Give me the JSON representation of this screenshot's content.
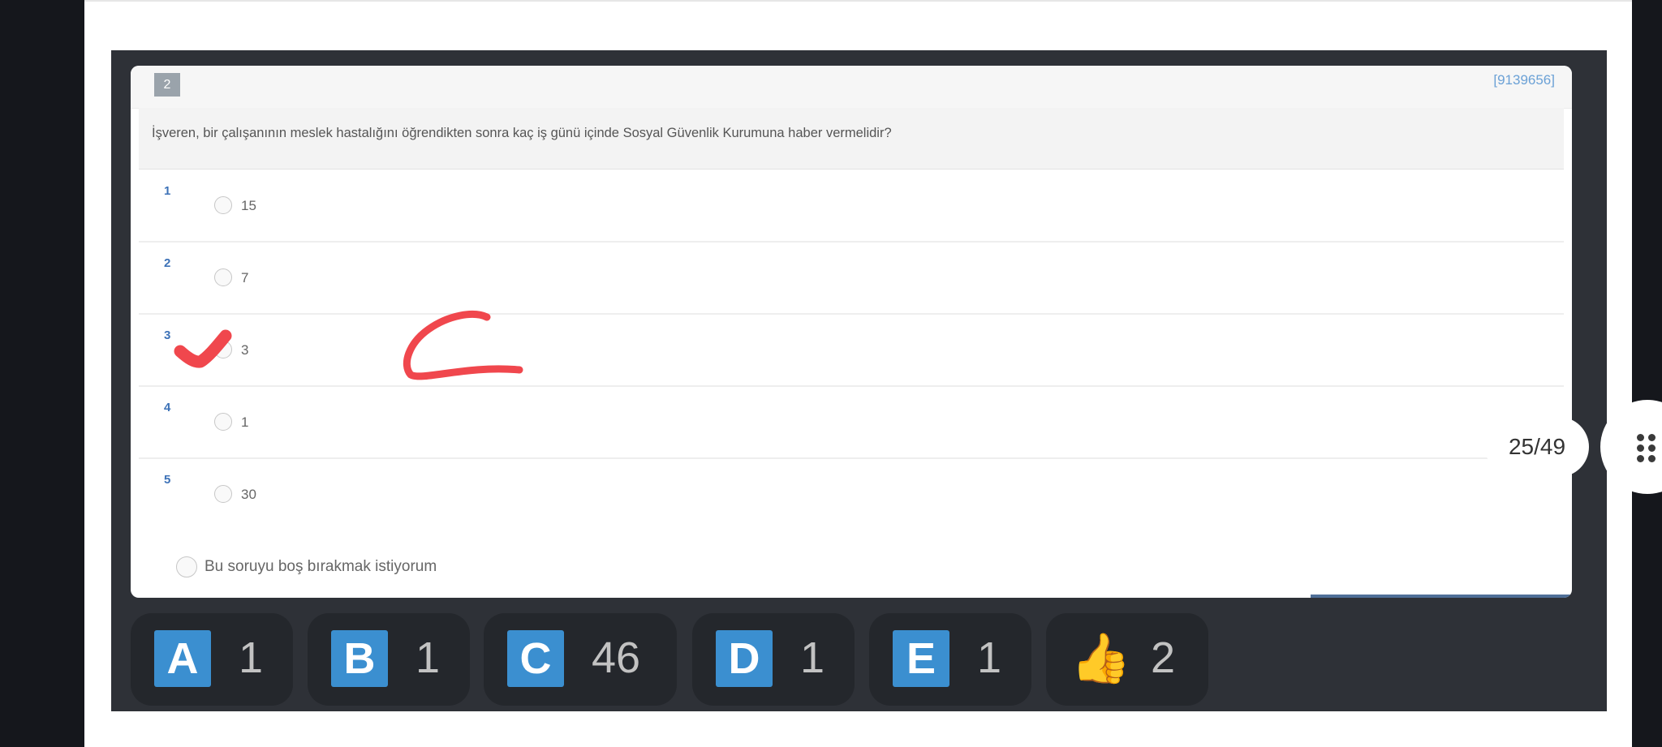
{
  "question": {
    "number": "2",
    "id": "[9139656]",
    "text": "İşveren, bir çalışanının meslek hastalığını öğrendikten sonra kaç iş günü içinde Sosyal Güvenlik Kurumuna haber vermelidir?",
    "options": [
      {
        "num": "1",
        "value": "15"
      },
      {
        "num": "2",
        "value": "7"
      },
      {
        "num": "3",
        "value": "3"
      },
      {
        "num": "4",
        "value": "1"
      },
      {
        "num": "5",
        "value": "30"
      }
    ],
    "skip_label": "Bu soruyu boş bırakmak istiyorum"
  },
  "answer_stats": [
    {
      "letter": "A",
      "count": "1"
    },
    {
      "letter": "B",
      "count": "1"
    },
    {
      "letter": "C",
      "count": "46"
    },
    {
      "letter": "D",
      "count": "1"
    },
    {
      "letter": "E",
      "count": "1"
    }
  ],
  "likes": {
    "icon": "thumbs-up-icon",
    "count": "2"
  },
  "pagination": {
    "label": "25/49"
  },
  "annotation": {
    "color": "#f0474d",
    "marked_option": "3",
    "written_letter": "C"
  },
  "colors": {
    "letter_badge": "#3b8fd0",
    "question_id": "#6ba1d6"
  }
}
